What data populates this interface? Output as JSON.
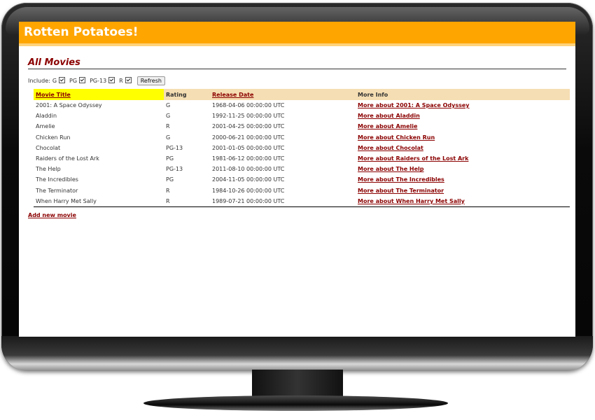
{
  "app": {
    "title": "Rotten Potatoes!"
  },
  "page": {
    "heading": "All Movies"
  },
  "filters": {
    "label": "Include:",
    "ratings": [
      {
        "label": "G",
        "checked": true
      },
      {
        "label": "PG",
        "checked": true
      },
      {
        "label": "PG-13",
        "checked": true
      },
      {
        "label": "R",
        "checked": true
      }
    ],
    "refresh_label": "Refresh"
  },
  "table": {
    "headers": [
      "Movie Title",
      "Rating",
      "Release Date",
      "More Info"
    ],
    "rows": [
      {
        "title": "2001: A Space Odyssey",
        "rating": "G",
        "date": "1968-04-06 00:00:00 UTC",
        "more": "More about 2001: A Space Odyssey"
      },
      {
        "title": "Aladdin",
        "rating": "G",
        "date": "1992-11-25 00:00:00 UTC",
        "more": "More about Aladdin"
      },
      {
        "title": "Amelie",
        "rating": "R",
        "date": "2001-04-25 00:00:00 UTC",
        "more": "More about Amelie"
      },
      {
        "title": "Chicken Run",
        "rating": "G",
        "date": "2000-06-21 00:00:00 UTC",
        "more": "More about Chicken Run"
      },
      {
        "title": "Chocolat",
        "rating": "PG-13",
        "date": "2001-01-05 00:00:00 UTC",
        "more": "More about Chocolat"
      },
      {
        "title": "Raiders of the Lost Ark",
        "rating": "PG",
        "date": "1981-06-12 00:00:00 UTC",
        "more": "More about Raiders of the Lost Ark"
      },
      {
        "title": "The Help",
        "rating": "PG-13",
        "date": "2011-08-10 00:00:00 UTC",
        "more": "More about The Help"
      },
      {
        "title": "The Incredibles",
        "rating": "PG",
        "date": "2004-11-05 00:00:00 UTC",
        "more": "More about The Incredibles"
      },
      {
        "title": "The Terminator",
        "rating": "R",
        "date": "1984-10-26 00:00:00 UTC",
        "more": "More about The Terminator"
      },
      {
        "title": "When Harry Met Sally",
        "rating": "R",
        "date": "1989-07-21 00:00:00 UTC",
        "more": "More about When Harry Met Sally"
      }
    ]
  },
  "actions": {
    "add_movie": "Add new movie"
  },
  "colors": {
    "header_bg": "#ffa500",
    "accent": "#8b0000",
    "table_header_bg": "#f5deb3",
    "sort_highlight": "#ffff00"
  }
}
